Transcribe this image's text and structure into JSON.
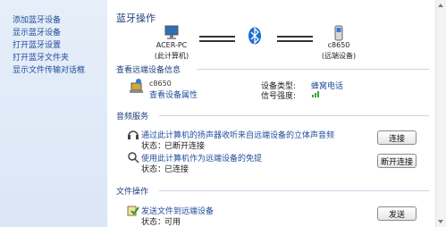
{
  "sidebar": {
    "items": [
      {
        "label": "添加蓝牙设备"
      },
      {
        "label": "显示蓝牙设备"
      },
      {
        "label": "打开蓝牙设置"
      },
      {
        "label": "打开蓝牙文件夹"
      },
      {
        "label": "显示文件传输对话框"
      }
    ]
  },
  "main": {
    "title": "蓝牙操作",
    "computer": {
      "name": "ACER-PC",
      "caption": "(此计算机)"
    },
    "remote": {
      "name": "c8650",
      "caption": "(远端设备)"
    },
    "info_section": {
      "title": "查看远端设备信息",
      "device_name": "c8650",
      "device_link": "查看设备属性",
      "type_label": "设备类型:",
      "type_value": "蜂窝电话",
      "signal_label": "信号强度:"
    },
    "audio_section": {
      "title": "音频服务",
      "item1": {
        "text": "通过此计算机的扬声器收听来自远端设备的立体声音频",
        "status_label": "状态：",
        "status_value": "已断开连接",
        "button": "连接"
      },
      "item2": {
        "text": "使用此计算机作为远端设备的免提",
        "status_label": "状态：",
        "status_value": "已连接",
        "button": "断开连接"
      }
    },
    "file_section": {
      "title": "文件操作",
      "item": {
        "text": "发送文件到远端设备",
        "status_label": "状态：",
        "status_value": "可用",
        "button": "发送"
      }
    }
  },
  "colors": {
    "link": "#1f4c9a",
    "heading": "#1e3f7a",
    "bluetooth": "#1a6fd0"
  }
}
